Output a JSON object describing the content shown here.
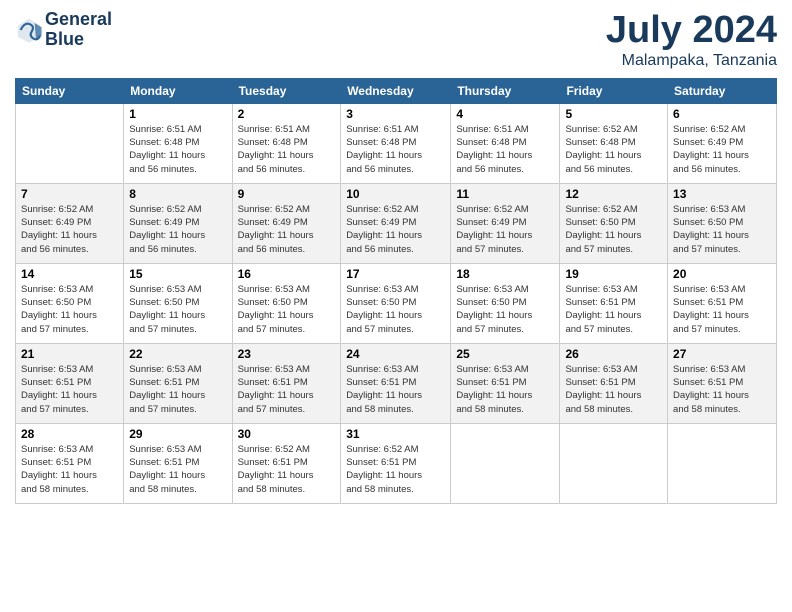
{
  "logo": {
    "line1": "General",
    "line2": "Blue"
  },
  "title": "July 2024",
  "subtitle": "Malampaka, Tanzania",
  "weekdays": [
    "Sunday",
    "Monday",
    "Tuesday",
    "Wednesday",
    "Thursday",
    "Friday",
    "Saturday"
  ],
  "weeks": [
    [
      {
        "day": "",
        "info": ""
      },
      {
        "day": "1",
        "info": "Sunrise: 6:51 AM\nSunset: 6:48 PM\nDaylight: 11 hours\nand 56 minutes."
      },
      {
        "day": "2",
        "info": "Sunrise: 6:51 AM\nSunset: 6:48 PM\nDaylight: 11 hours\nand 56 minutes."
      },
      {
        "day": "3",
        "info": "Sunrise: 6:51 AM\nSunset: 6:48 PM\nDaylight: 11 hours\nand 56 minutes."
      },
      {
        "day": "4",
        "info": "Sunrise: 6:51 AM\nSunset: 6:48 PM\nDaylight: 11 hours\nand 56 minutes."
      },
      {
        "day": "5",
        "info": "Sunrise: 6:52 AM\nSunset: 6:48 PM\nDaylight: 11 hours\nand 56 minutes."
      },
      {
        "day": "6",
        "info": "Sunrise: 6:52 AM\nSunset: 6:49 PM\nDaylight: 11 hours\nand 56 minutes."
      }
    ],
    [
      {
        "day": "7",
        "info": "Sunrise: 6:52 AM\nSunset: 6:49 PM\nDaylight: 11 hours\nand 56 minutes."
      },
      {
        "day": "8",
        "info": "Sunrise: 6:52 AM\nSunset: 6:49 PM\nDaylight: 11 hours\nand 56 minutes."
      },
      {
        "day": "9",
        "info": "Sunrise: 6:52 AM\nSunset: 6:49 PM\nDaylight: 11 hours\nand 56 minutes."
      },
      {
        "day": "10",
        "info": "Sunrise: 6:52 AM\nSunset: 6:49 PM\nDaylight: 11 hours\nand 56 minutes."
      },
      {
        "day": "11",
        "info": "Sunrise: 6:52 AM\nSunset: 6:49 PM\nDaylight: 11 hours\nand 57 minutes."
      },
      {
        "day": "12",
        "info": "Sunrise: 6:52 AM\nSunset: 6:50 PM\nDaylight: 11 hours\nand 57 minutes."
      },
      {
        "day": "13",
        "info": "Sunrise: 6:53 AM\nSunset: 6:50 PM\nDaylight: 11 hours\nand 57 minutes."
      }
    ],
    [
      {
        "day": "14",
        "info": "Sunrise: 6:53 AM\nSunset: 6:50 PM\nDaylight: 11 hours\nand 57 minutes."
      },
      {
        "day": "15",
        "info": "Sunrise: 6:53 AM\nSunset: 6:50 PM\nDaylight: 11 hours\nand 57 minutes."
      },
      {
        "day": "16",
        "info": "Sunrise: 6:53 AM\nSunset: 6:50 PM\nDaylight: 11 hours\nand 57 minutes."
      },
      {
        "day": "17",
        "info": "Sunrise: 6:53 AM\nSunset: 6:50 PM\nDaylight: 11 hours\nand 57 minutes."
      },
      {
        "day": "18",
        "info": "Sunrise: 6:53 AM\nSunset: 6:50 PM\nDaylight: 11 hours\nand 57 minutes."
      },
      {
        "day": "19",
        "info": "Sunrise: 6:53 AM\nSunset: 6:51 PM\nDaylight: 11 hours\nand 57 minutes."
      },
      {
        "day": "20",
        "info": "Sunrise: 6:53 AM\nSunset: 6:51 PM\nDaylight: 11 hours\nand 57 minutes."
      }
    ],
    [
      {
        "day": "21",
        "info": "Sunrise: 6:53 AM\nSunset: 6:51 PM\nDaylight: 11 hours\nand 57 minutes."
      },
      {
        "day": "22",
        "info": "Sunrise: 6:53 AM\nSunset: 6:51 PM\nDaylight: 11 hours\nand 57 minutes."
      },
      {
        "day": "23",
        "info": "Sunrise: 6:53 AM\nSunset: 6:51 PM\nDaylight: 11 hours\nand 57 minutes."
      },
      {
        "day": "24",
        "info": "Sunrise: 6:53 AM\nSunset: 6:51 PM\nDaylight: 11 hours\nand 58 minutes."
      },
      {
        "day": "25",
        "info": "Sunrise: 6:53 AM\nSunset: 6:51 PM\nDaylight: 11 hours\nand 58 minutes."
      },
      {
        "day": "26",
        "info": "Sunrise: 6:53 AM\nSunset: 6:51 PM\nDaylight: 11 hours\nand 58 minutes."
      },
      {
        "day": "27",
        "info": "Sunrise: 6:53 AM\nSunset: 6:51 PM\nDaylight: 11 hours\nand 58 minutes."
      }
    ],
    [
      {
        "day": "28",
        "info": "Sunrise: 6:53 AM\nSunset: 6:51 PM\nDaylight: 11 hours\nand 58 minutes."
      },
      {
        "day": "29",
        "info": "Sunrise: 6:53 AM\nSunset: 6:51 PM\nDaylight: 11 hours\nand 58 minutes."
      },
      {
        "day": "30",
        "info": "Sunrise: 6:52 AM\nSunset: 6:51 PM\nDaylight: 11 hours\nand 58 minutes."
      },
      {
        "day": "31",
        "info": "Sunrise: 6:52 AM\nSunset: 6:51 PM\nDaylight: 11 hours\nand 58 minutes."
      },
      {
        "day": "",
        "info": ""
      },
      {
        "day": "",
        "info": ""
      },
      {
        "day": "",
        "info": ""
      }
    ]
  ]
}
